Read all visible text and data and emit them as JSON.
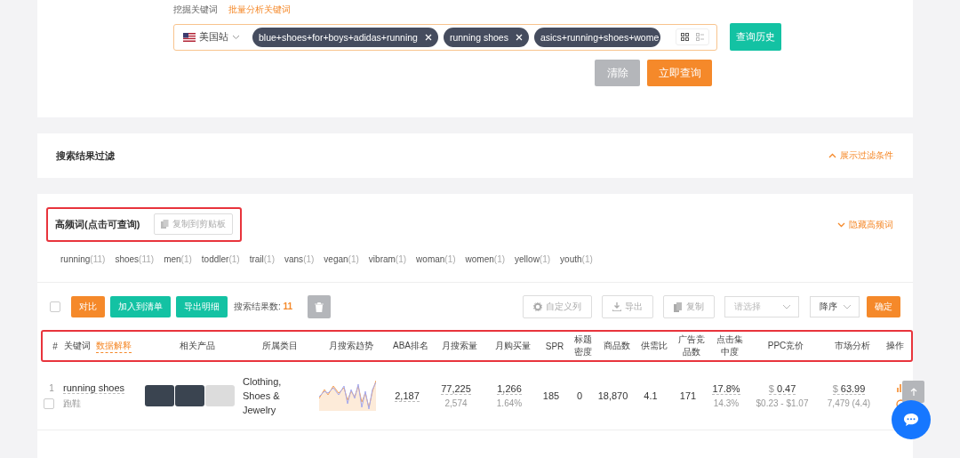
{
  "tabs": [
    {
      "label": "挖掘关键词",
      "selected": false
    },
    {
      "label": "批量分析关键词",
      "selected": true
    }
  ],
  "search": {
    "site": "美国站",
    "tags": [
      {
        "text": "blue+shoes+for+boys+adidas+running",
        "removable": true
      },
      {
        "text": "running shoes",
        "removable": true
      },
      {
        "text": "asics+running+shoes+wome",
        "removable": false
      }
    ],
    "view_modes": [
      {
        "selected": true
      },
      {
        "selected": false
      }
    ],
    "history_button": "查询历史",
    "clear_button": "清除",
    "query_button": "立即查询"
  },
  "filter": {
    "title": "搜索结果过滤",
    "toggle": "展示过滤条件"
  },
  "high_freq": {
    "title": "高频词(点击可查询)",
    "copy_button": "复制到剪贴板",
    "toggle": "隐藏高频词",
    "words": [
      {
        "word": "running",
        "count": "(11)"
      },
      {
        "word": "shoes",
        "count": "(11)"
      },
      {
        "word": "men",
        "count": "(1)"
      },
      {
        "word": "toddler",
        "count": "(1)"
      },
      {
        "word": "trail",
        "count": "(1)"
      },
      {
        "word": "vans",
        "count": "(1)"
      },
      {
        "word": "vegan",
        "count": "(1)"
      },
      {
        "word": "vibram",
        "count": "(1)"
      },
      {
        "word": "woman",
        "count": "(1)"
      },
      {
        "word": "women",
        "count": "(1)"
      },
      {
        "word": "yellow",
        "count": "(1)"
      },
      {
        "word": "youth",
        "count": "(1)"
      }
    ]
  },
  "toolbar": {
    "select_all": {
      "checked": false
    },
    "compare_button": "对比",
    "add_list_button": "加入到清单",
    "export_detail_button": "导出明细",
    "result_label": "搜索结果数:",
    "result_count": "11",
    "custom_columns_button": "自定义列",
    "export_button": "导出",
    "copy_button": "复制",
    "select_placeholder": "请选择",
    "sort_value": "降序",
    "confirm_button": "确定"
  },
  "table": {
    "columns": [
      {
        "label": "#"
      },
      {
        "label": "关键词",
        "link": "数据解释"
      },
      {
        "label": "相关产品"
      },
      {
        "label": "所属类目"
      },
      {
        "label": "月搜索趋势"
      },
      {
        "label": "ABA排名"
      },
      {
        "label": "月搜索量"
      },
      {
        "label": "月购买量"
      },
      {
        "label": "SPR"
      },
      {
        "label": "标题密度"
      },
      {
        "label": "商品数"
      },
      {
        "label": "供需比"
      },
      {
        "label": "广告竞品数"
      },
      {
        "label": "点击集中度"
      },
      {
        "label": "PPC竞价"
      },
      {
        "label": "市场分析"
      },
      {
        "label": "操作"
      }
    ],
    "rows": [
      {
        "index": "1",
        "checked": false,
        "keyword": "running shoes",
        "translation": "跑鞋",
        "category": "Clothing, Shoes & Jewelry",
        "aba_rank": "2,187",
        "monthly_search": "77,225",
        "search_sub": "2,574",
        "monthly_purchase": "1,266",
        "purchase_rate": "1.64%",
        "spr": "185",
        "title_density": "0",
        "products": "18,870",
        "supply_ratio": "4.1",
        "ad_products": "171",
        "click_share": "17.8%",
        "click_sub": "14.3%",
        "ppc_currency": "$",
        "ppc": "0.47",
        "ppc_range": "$0.23 - $1.07",
        "market_currency": "$",
        "market_price": "63.99",
        "market_sub": "7,479 (4.4)"
      }
    ]
  }
}
